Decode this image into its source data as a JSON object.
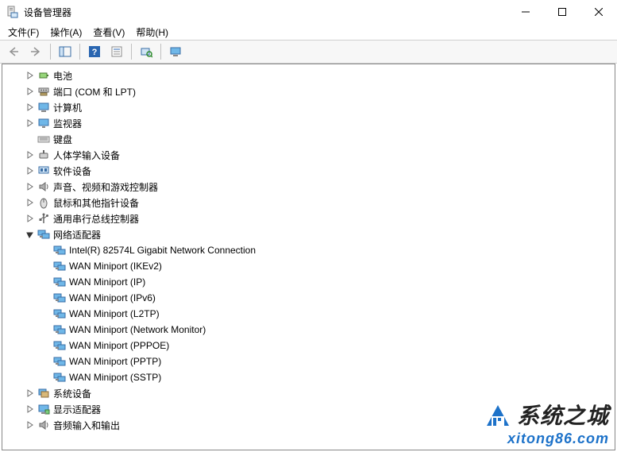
{
  "window": {
    "title": "设备管理器"
  },
  "menu": {
    "file": "文件(F)",
    "action": "操作(A)",
    "view": "查看(V)",
    "help": "帮助(H)"
  },
  "tree": [
    {
      "depth": 1,
      "expander": "closed",
      "icon": "battery",
      "label": "电池"
    },
    {
      "depth": 1,
      "expander": "closed",
      "icon": "port",
      "label": "端口 (COM 和 LPT)"
    },
    {
      "depth": 1,
      "expander": "closed",
      "icon": "computer",
      "label": "计算机"
    },
    {
      "depth": 1,
      "expander": "closed",
      "icon": "monitor",
      "label": "监视器"
    },
    {
      "depth": 1,
      "expander": "none",
      "icon": "keyboard",
      "label": "键盘"
    },
    {
      "depth": 1,
      "expander": "closed",
      "icon": "hid",
      "label": "人体学输入设备"
    },
    {
      "depth": 1,
      "expander": "closed",
      "icon": "software",
      "label": "软件设备"
    },
    {
      "depth": 1,
      "expander": "closed",
      "icon": "audio",
      "label": "声音、视频和游戏控制器"
    },
    {
      "depth": 1,
      "expander": "closed",
      "icon": "mouse",
      "label": "鼠标和其他指针设备"
    },
    {
      "depth": 1,
      "expander": "closed",
      "icon": "usb",
      "label": "通用串行总线控制器"
    },
    {
      "depth": 1,
      "expander": "open",
      "icon": "network",
      "label": "网络适配器"
    },
    {
      "depth": 2,
      "expander": "none",
      "icon": "network",
      "label": "Intel(R) 82574L Gigabit Network Connection"
    },
    {
      "depth": 2,
      "expander": "none",
      "icon": "network",
      "label": "WAN Miniport (IKEv2)"
    },
    {
      "depth": 2,
      "expander": "none",
      "icon": "network",
      "label": "WAN Miniport (IP)"
    },
    {
      "depth": 2,
      "expander": "none",
      "icon": "network",
      "label": "WAN Miniport (IPv6)"
    },
    {
      "depth": 2,
      "expander": "none",
      "icon": "network",
      "label": "WAN Miniport (L2TP)"
    },
    {
      "depth": 2,
      "expander": "none",
      "icon": "network",
      "label": "WAN Miniport (Network Monitor)"
    },
    {
      "depth": 2,
      "expander": "none",
      "icon": "network",
      "label": "WAN Miniport (PPPOE)"
    },
    {
      "depth": 2,
      "expander": "none",
      "icon": "network",
      "label": "WAN Miniport (PPTP)"
    },
    {
      "depth": 2,
      "expander": "none",
      "icon": "network",
      "label": "WAN Miniport (SSTP)"
    },
    {
      "depth": 1,
      "expander": "closed",
      "icon": "system",
      "label": "系统设备"
    },
    {
      "depth": 1,
      "expander": "closed",
      "icon": "display",
      "label": "显示适配器"
    },
    {
      "depth": 1,
      "expander": "closed",
      "icon": "audio",
      "label": "音频输入和输出"
    }
  ],
  "watermark": {
    "brand": "系统之城",
    "url": "xitong86.com"
  }
}
